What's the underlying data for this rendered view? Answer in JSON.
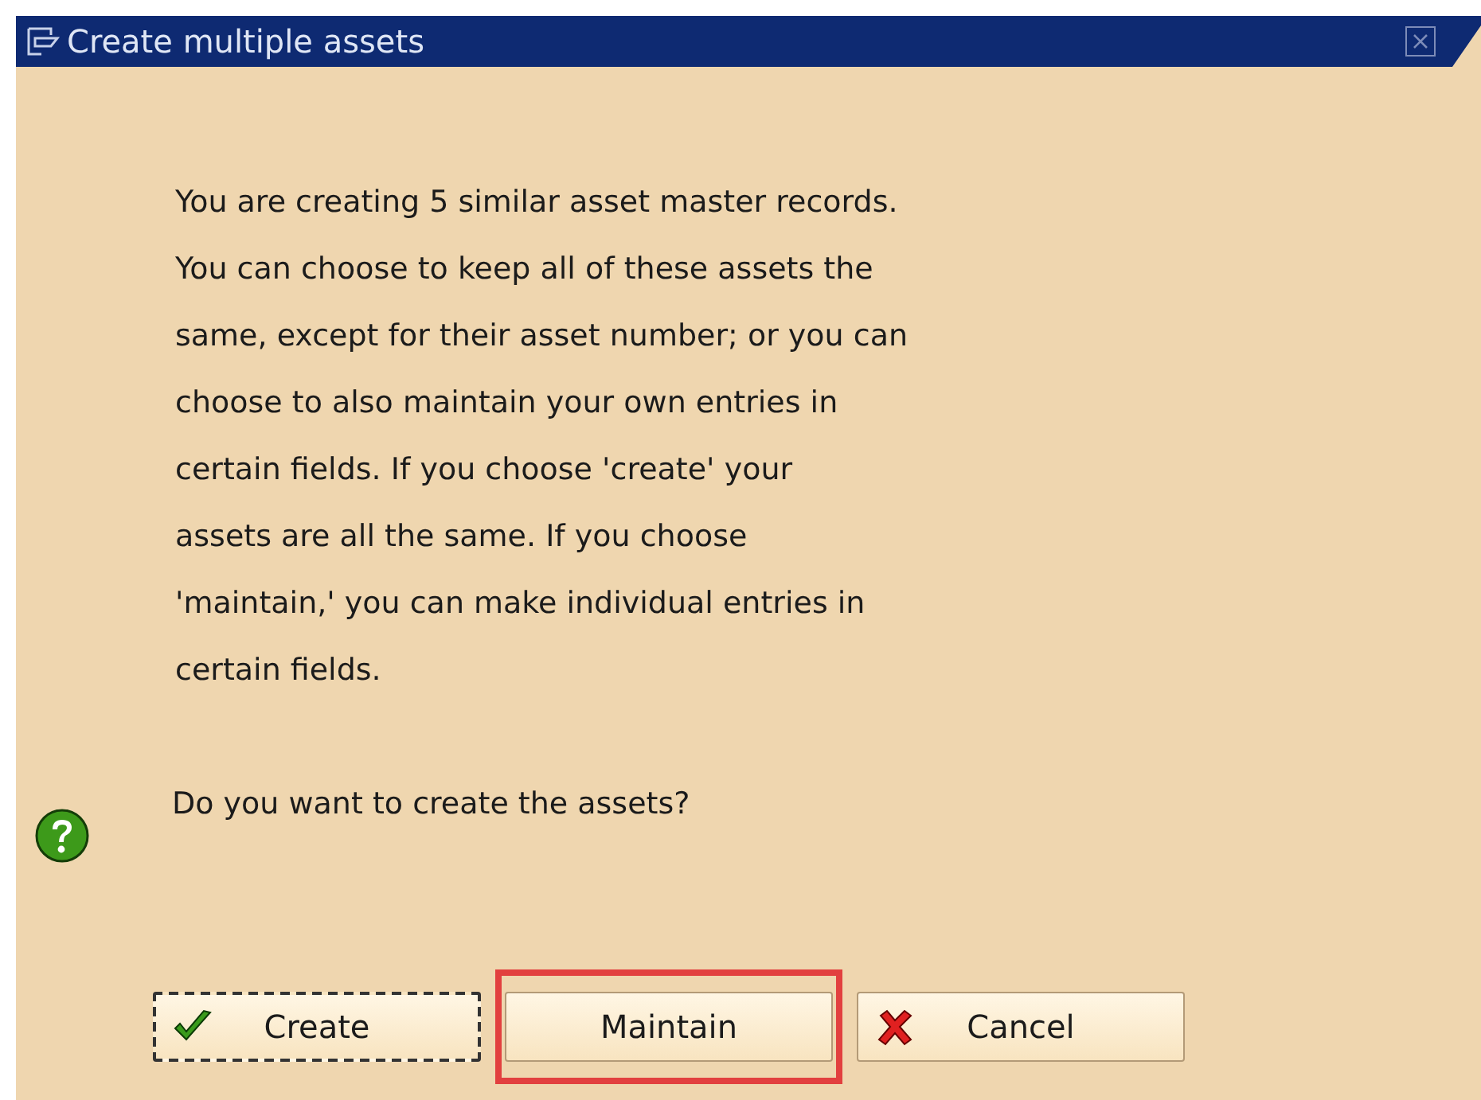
{
  "window": {
    "title": "Create multiple assets"
  },
  "message": {
    "lines": [
      "You are creating 5 similar asset master records.",
      "You can choose to keep all of these assets the",
      "same, except for their asset number; or you can",
      "choose to also maintain your own entries in",
      "certain fields. If you choose 'create' your",
      "assets are all the same. If you choose",
      "'maintain,' you can make individual entries in",
      "certain fields."
    ],
    "question": "Do you want to create the assets?"
  },
  "buttons": [
    {
      "label": "Create",
      "kind": "confirm",
      "focused": true,
      "highlighted": false
    },
    {
      "label": "Maintain",
      "kind": "plain",
      "focused": false,
      "highlighted": true
    },
    {
      "label": "Cancel",
      "kind": "cancel",
      "focused": false,
      "highlighted": false
    }
  ]
}
